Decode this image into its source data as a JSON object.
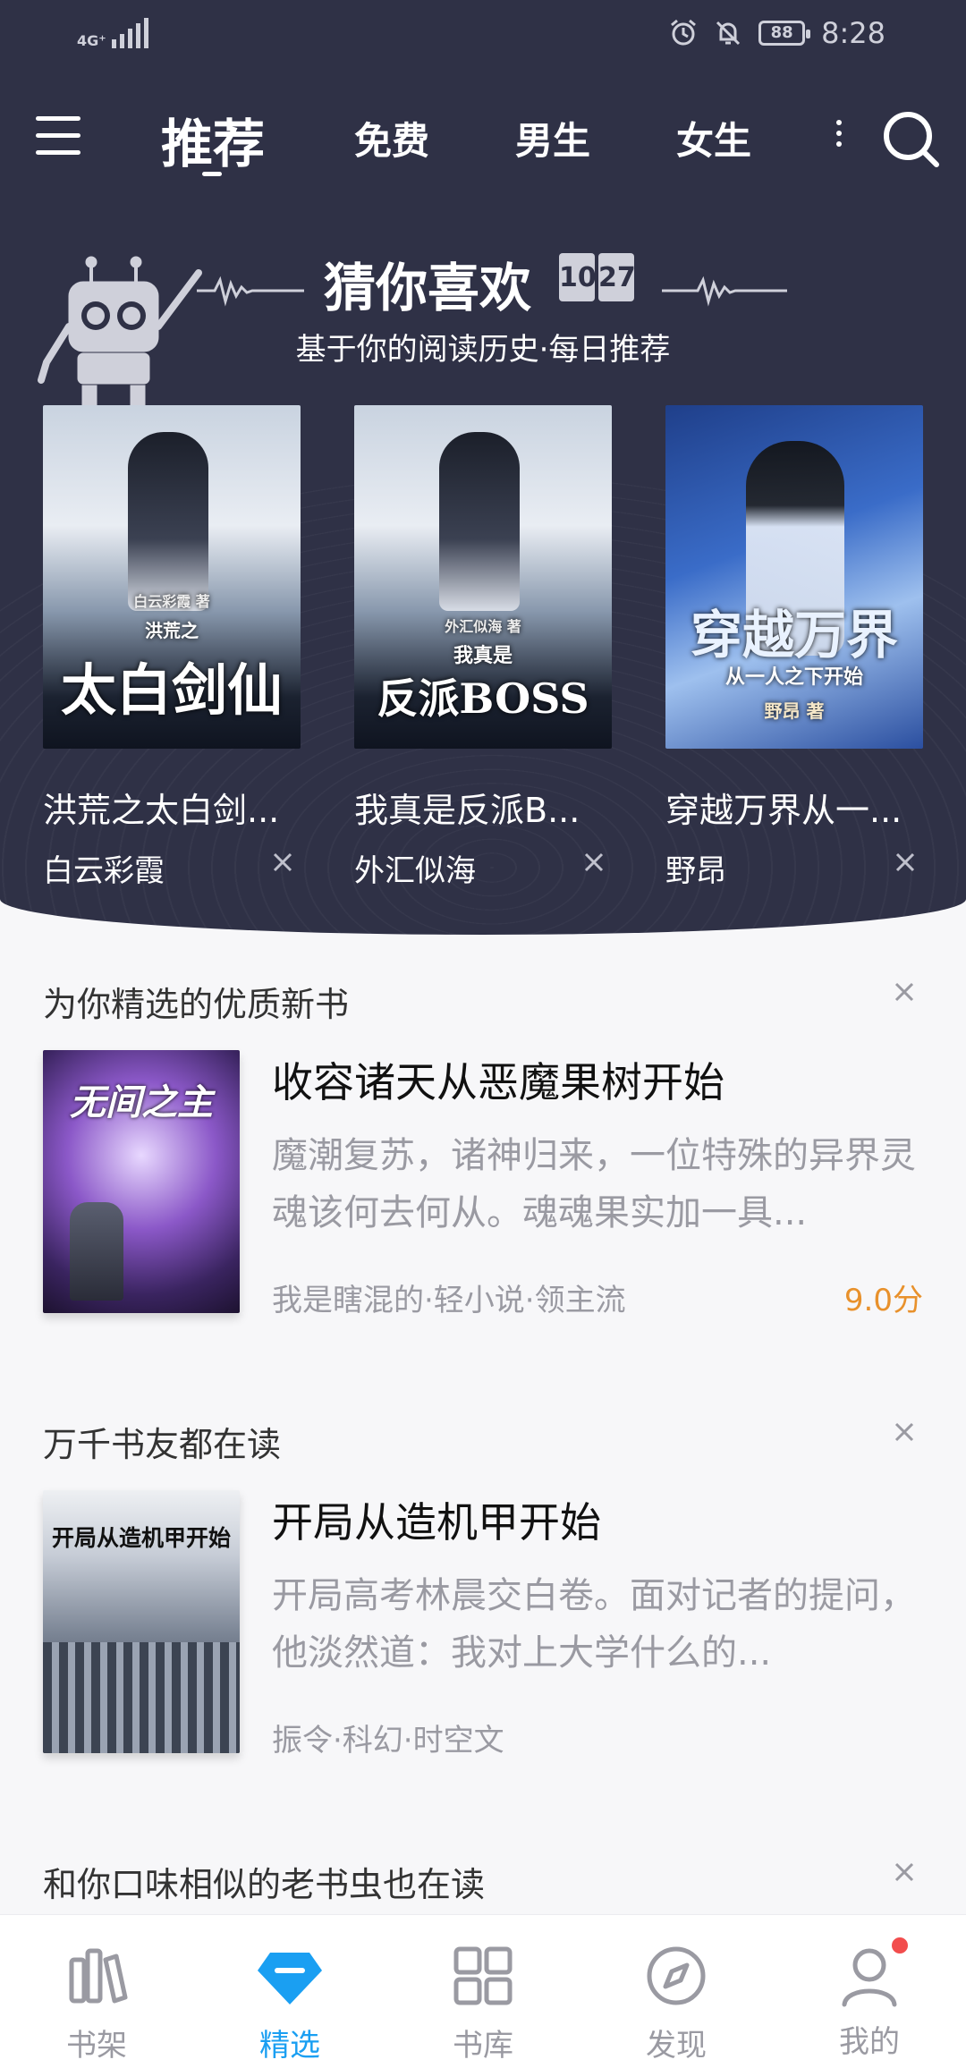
{
  "status_bar": {
    "network": "4G⁺",
    "battery": "88",
    "time": "8:28"
  },
  "top_tabs": [
    {
      "label": "推荐",
      "active": true
    },
    {
      "label": "免费",
      "active": false
    },
    {
      "label": "男生",
      "active": false
    },
    {
      "label": "女生",
      "active": false
    }
  ],
  "guess": {
    "title": "猜你喜欢",
    "date_month": "10",
    "date_day": "27",
    "subtitle": "基于你的阅读历史·每日推荐"
  },
  "rec_books": [
    {
      "title": "洪荒之太白剑...",
      "author": "白云彩霞",
      "cover_text": "太白剑仙",
      "cover_top": "洪荒之",
      "cover_author": "白云彩霞 著"
    },
    {
      "title": "我真是反派B...",
      "author": "外汇似海",
      "cover_text": "反派BOSS",
      "cover_top": "我真是",
      "cover_author": "外汇似海 著"
    },
    {
      "title": "穿越万界从一...",
      "author": "野昂",
      "cover_text": "穿越万界",
      "cover_top": "从一人之下开始",
      "cover_author": "野昂 著"
    }
  ],
  "sections": [
    {
      "heading": "为你精选的优质新书",
      "book": {
        "title": "收容诸天从恶魔果树开始",
        "desc": "魔潮复苏，诸神归来，一位特殊的异界灵魂该何去何从。魂魂果实加一具...",
        "meta": "我是瞎混的·轻小说·领主流",
        "score": "9.0分",
        "cover_text": "无间之主"
      }
    },
    {
      "heading": "万千书友都在读",
      "book": {
        "title": "开局从造机甲开始",
        "desc": "开局高考林晨交白卷。面对记者的提问，他淡然道：我对上大学什么的...",
        "meta": "振令·科幻·时空文",
        "score": "",
        "cover_text": "开局从造机甲开始"
      }
    },
    {
      "heading": "和你口味相似的老书虫也在读"
    }
  ],
  "bottom_nav": [
    {
      "label": "书架",
      "icon": "bookshelf-icon"
    },
    {
      "label": "精选",
      "icon": "diamond-icon",
      "active": true
    },
    {
      "label": "书库",
      "icon": "grid-icon"
    },
    {
      "label": "发现",
      "icon": "compass-icon"
    },
    {
      "label": "我的",
      "icon": "user-icon"
    }
  ],
  "colors": {
    "hero_bg": "#2f3146",
    "accent": "#1a9ff2",
    "score": "#e8912c",
    "badge": "#f24d4d"
  }
}
